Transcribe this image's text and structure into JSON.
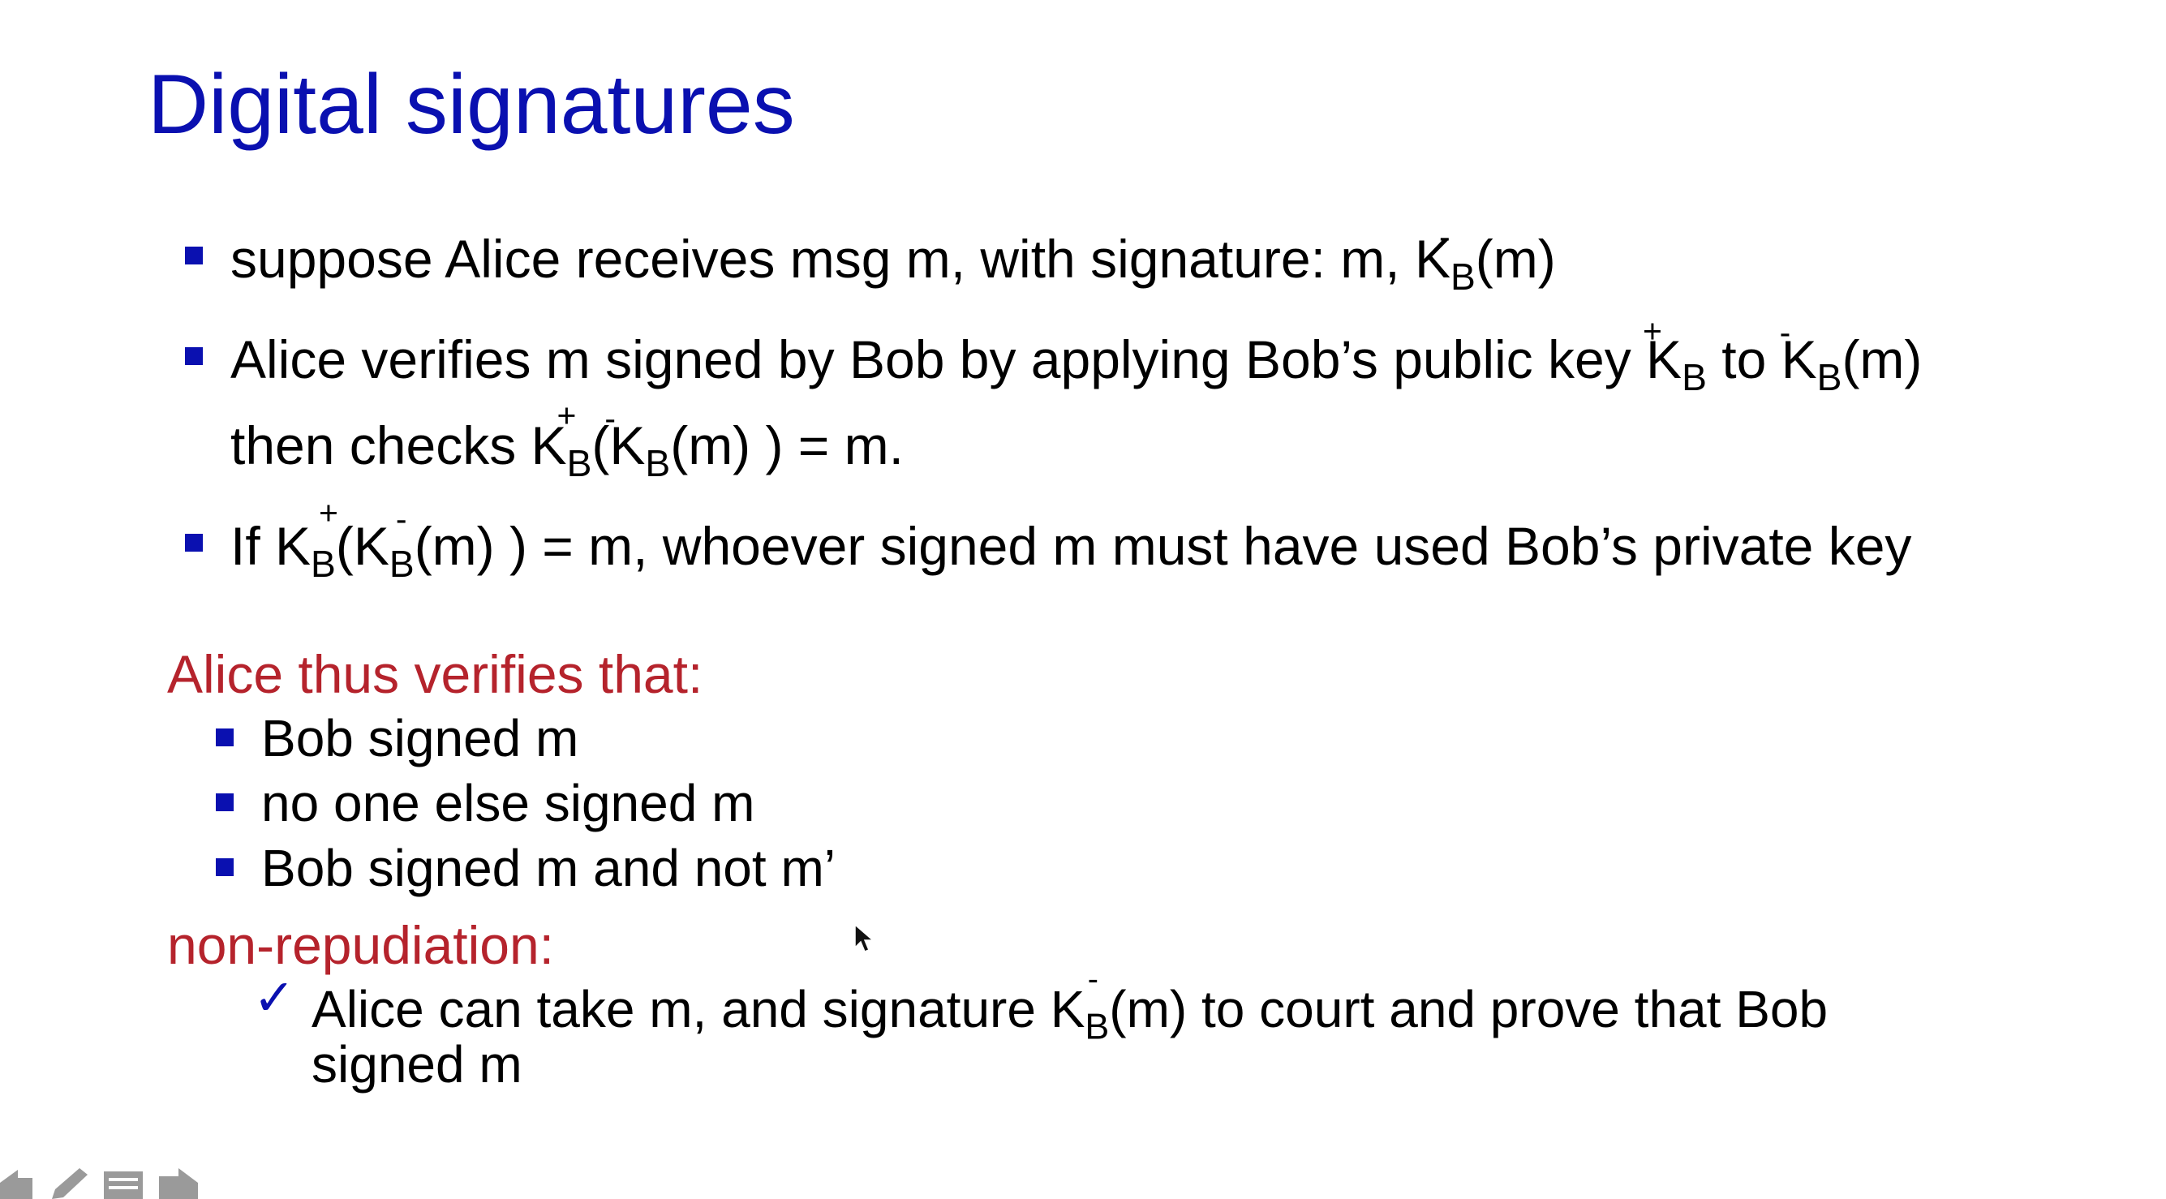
{
  "title": "Digital signatures",
  "bullets": [
    {
      "text_pre": "suppose Alice receives msg m, with signature: m, ",
      "k": "K",
      "k_sub": "B",
      "k_sup": "-",
      "text_post": "(m)"
    },
    {
      "line1_pre": "Alice verifies m signed by Bob by applying Bob’s public key ",
      "k1": "K",
      "k1_sub": "B",
      "k1_sup": "+",
      "mid": " to ",
      "k2": "K",
      "k2_sub": "B",
      "k2_sup": "-",
      "line1_post": "(m)",
      "line2_pre": "then checks ",
      "k3": "K",
      "k3_sub": "B",
      "k3_sup": "+",
      "paren": "(",
      "k4": "K",
      "k4_sub": "B",
      "k4_sup": "-",
      "line2_post": "(m) ) = m."
    },
    {
      "pre": "If ",
      "k1": "K",
      "k1_sub": "B",
      "k1_sup": "+",
      "paren": "(",
      "k2": "K",
      "k2_sub": "B",
      "k2_sup": "-",
      "post": "(m) ) = m, whoever signed m must have used Bob’s private key"
    }
  ],
  "verifies": {
    "heading": "Alice thus verifies that:",
    "items": [
      "Bob signed m",
      "no one else signed m",
      "Bob signed m and not m’"
    ]
  },
  "nonrep": {
    "heading": "non-repudiation:",
    "check": "✓",
    "line1_pre": "Alice can take m, and signature ",
    "k": "K",
    "k_sub": "B",
    "k_sup": "-",
    "line1_post": "(m) to court and prove that Bob",
    "line2": "signed m"
  },
  "colors": {
    "title": "#0a10b0",
    "bullet": "#0a10b0",
    "heading_red": "#b5232c"
  }
}
